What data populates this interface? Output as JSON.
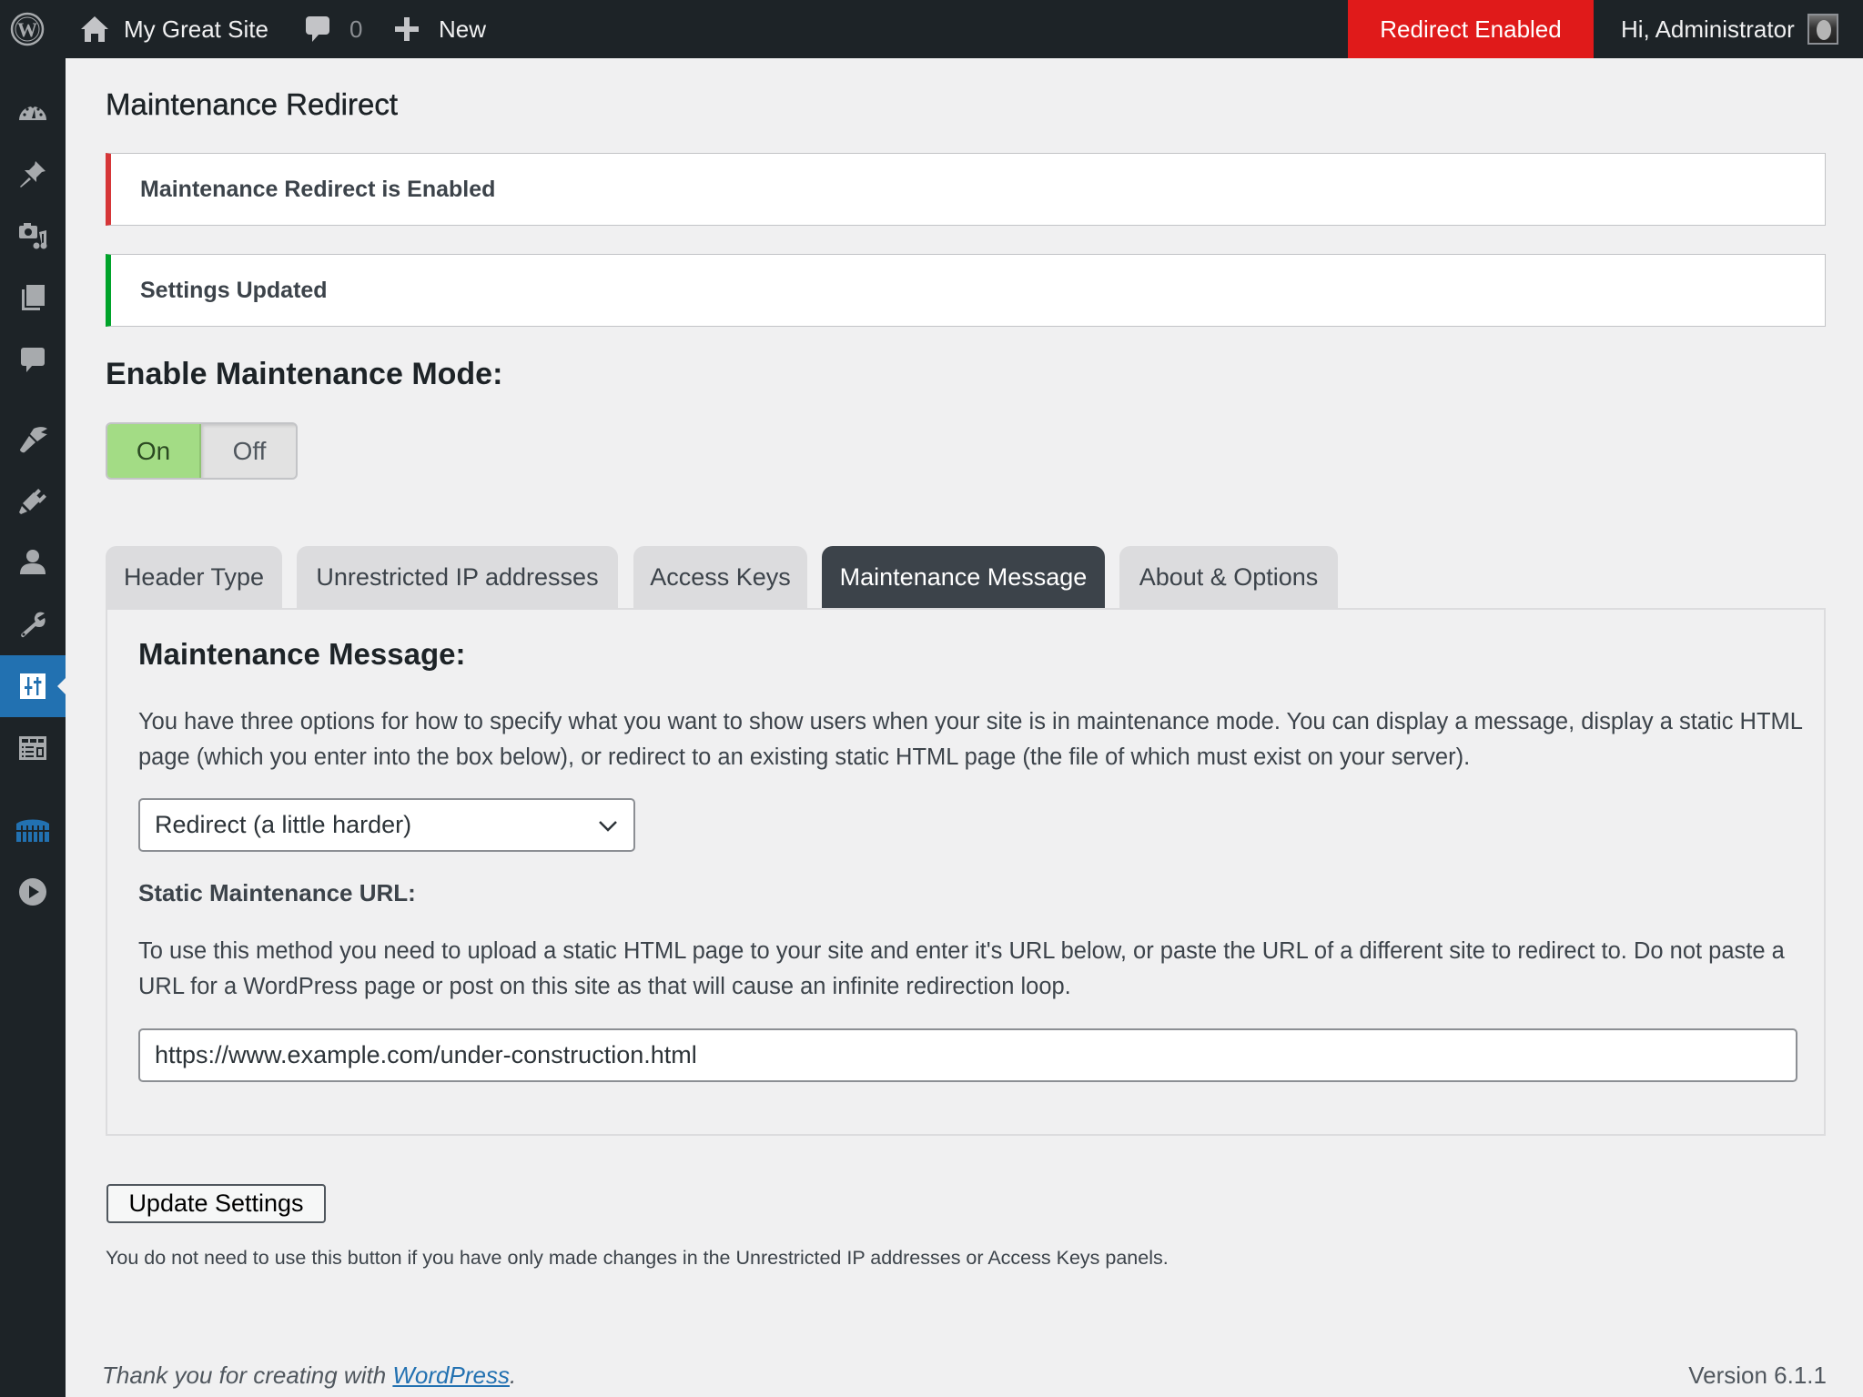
{
  "admin_bar": {
    "wp_logo_icon": "wordpress-logo-icon",
    "site_name": "My Great Site",
    "site_icon": "home-icon",
    "comments_icon": "comment-bubble-icon",
    "comments_count": "0",
    "new_icon": "plus-icon",
    "new_label": "New",
    "redirect_status": "Redirect Enabled",
    "redirect_status_color": "#e01a1a",
    "greeting": "Hi, Administrator"
  },
  "sidebar": {
    "items": [
      {
        "name": "dashboard",
        "icon": "dashboard-gauge-icon"
      },
      {
        "name": "posts",
        "icon": "pushpin-icon"
      },
      {
        "name": "media",
        "icon": "camera-music-icon"
      },
      {
        "name": "pages",
        "icon": "pages-icon"
      },
      {
        "name": "comments",
        "icon": "comment-bubble-icon"
      },
      {
        "name": "appearance",
        "icon": "paintbrush-icon"
      },
      {
        "name": "plugins",
        "icon": "plug-icon"
      },
      {
        "name": "users",
        "icon": "user-icon"
      },
      {
        "name": "tools",
        "icon": "wrench-icon"
      },
      {
        "name": "settings",
        "icon": "sliders-icon",
        "current": true
      },
      {
        "name": "layout",
        "icon": "table-layout-icon"
      },
      {
        "name": "security",
        "icon": "fortress-icon"
      },
      {
        "name": "media-player",
        "icon": "play-circle-icon"
      }
    ],
    "accent_color": "#2271b1"
  },
  "page": {
    "title": "Maintenance Redirect",
    "notices": [
      {
        "type": "error",
        "text": "Maintenance Redirect is Enabled",
        "color": "#d63638"
      },
      {
        "type": "success",
        "text": "Settings Updated",
        "color": "#00a32a"
      }
    ],
    "enable_heading": "Enable Maintenance Mode:",
    "toggle": {
      "on_label": "On",
      "off_label": "Off",
      "selected": "On",
      "on_color": "#a3dc85"
    },
    "tabs": [
      {
        "label": "Header Type",
        "active": false
      },
      {
        "label": "Unrestricted IP addresses",
        "active": false
      },
      {
        "label": "Access Keys",
        "active": false
      },
      {
        "label": "Maintenance Message",
        "active": true
      },
      {
        "label": "About & Options",
        "active": false
      }
    ],
    "panel": {
      "heading": "Maintenance Message:",
      "description": "You have three options for how to specify what you want to show users when your site is in maintenance mode. You can display a message, display a static HTML page (which you enter into the box below), or redirect to an existing static HTML page (the file of which must exist on your server).",
      "mode_select": {
        "selected": "Redirect (a little harder)"
      },
      "url_label": "Static Maintenance URL:",
      "url_description": "To use this method you need to upload a static HTML page to your site and enter it's URL below, or paste the URL of a different site to redirect to. Do not paste a URL for a WordPress page or post on this site as that will cause an infinite redirection loop.",
      "url_value": "https://www.example.com/under-construction.html"
    },
    "update_button": "Update Settings",
    "update_note": "You do not need to use this button if you have only made changes in the Unrestricted IP addresses or Access Keys panels."
  },
  "footer": {
    "thanks_prefix": "Thank you for creating with ",
    "thanks_link": "WordPress",
    "thanks_suffix": ".",
    "version": "Version 6.1.1"
  }
}
